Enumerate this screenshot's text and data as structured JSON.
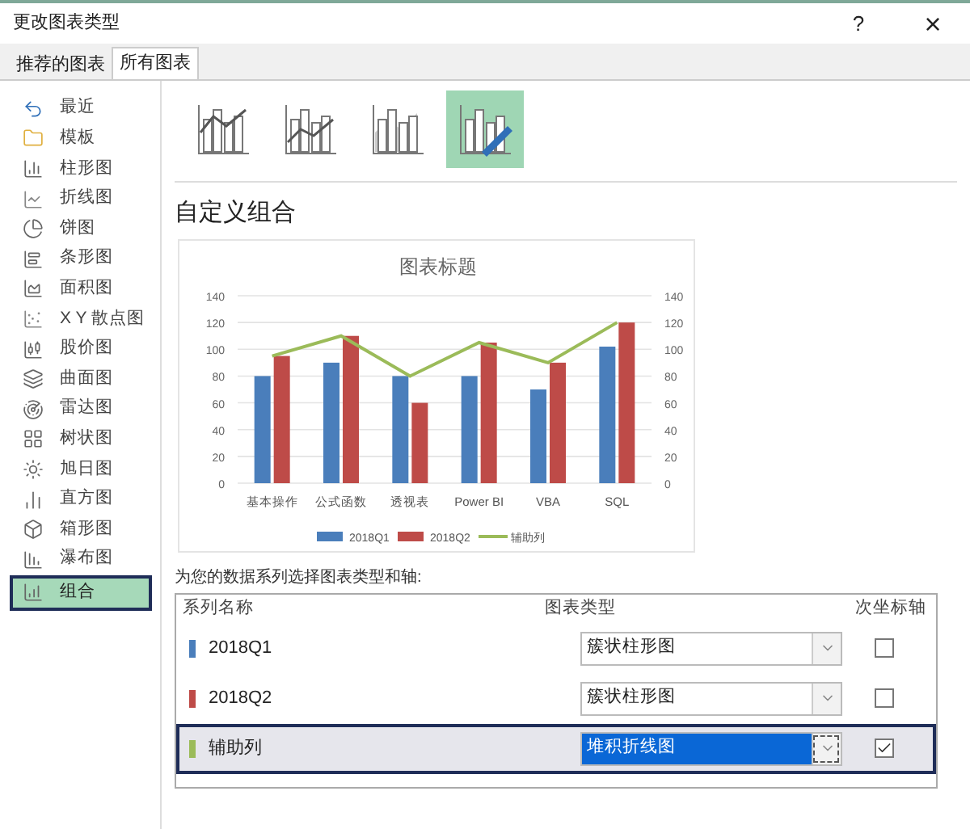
{
  "window": {
    "title": "更改图表类型",
    "help": "?",
    "close": "×"
  },
  "tabs": [
    {
      "label": "推荐的图表",
      "selected": false
    },
    {
      "label": "所有图表",
      "selected": true
    }
  ],
  "sidebar": {
    "items": [
      {
        "label": "最近",
        "selected": false
      },
      {
        "label": "模板",
        "selected": false
      },
      {
        "label": "柱形图",
        "selected": false
      },
      {
        "label": "折线图",
        "selected": false
      },
      {
        "label": "饼图",
        "selected": false
      },
      {
        "label": "条形图",
        "selected": false
      },
      {
        "label": "面积图",
        "selected": false
      },
      {
        "label": "X Y 散点图",
        "selected": false
      },
      {
        "label": "股价图",
        "selected": false
      },
      {
        "label": "曲面图",
        "selected": false
      },
      {
        "label": "雷达图",
        "selected": false
      },
      {
        "label": "树状图",
        "selected": false
      },
      {
        "label": "旭日图",
        "selected": false
      },
      {
        "label": "直方图",
        "selected": false
      },
      {
        "label": "箱形图",
        "selected": false
      },
      {
        "label": "瀑布图",
        "selected": false
      },
      {
        "label": "组合",
        "selected": true
      }
    ]
  },
  "subtypes": [
    {
      "selected": false
    },
    {
      "selected": false
    },
    {
      "selected": false
    },
    {
      "selected": true
    }
  ],
  "heading": "自定义组合",
  "chart": {
    "chart_data": {
      "type": "bar",
      "title": "图表标题",
      "categories": [
        "基本操作",
        "公式函数",
        "透视表",
        "Power BI",
        "VBA",
        "SQL"
      ],
      "series": [
        {
          "name": "2018Q1",
          "color": "#4a7ebb",
          "type": "bar",
          "values": [
            80,
            90,
            80,
            80,
            70,
            102
          ]
        },
        {
          "name": "2018Q2",
          "color": "#be4b48",
          "type": "bar",
          "values": [
            95,
            110,
            60,
            105,
            90,
            120
          ]
        },
        {
          "name": "辅助列",
          "color": "#9bbb59",
          "type": "line",
          "values": [
            95,
            110,
            80,
            105,
            90,
            120
          ]
        }
      ],
      "grid": true,
      "legend": "bottom",
      "ylim": [
        0,
        140
      ],
      "yticks": [
        0,
        20,
        40,
        60,
        80,
        100,
        120,
        140
      ]
    },
    "secondary_axis_labels": [
      "140",
      "120",
      "100",
      "80",
      "60",
      "40",
      "20",
      "0"
    ]
  },
  "series_prompt": "为您的数据系列选择图表类型和轴:",
  "series_table": {
    "columns": [
      "系列名称",
      "图表类型",
      "次坐标轴"
    ],
    "rows": [
      {
        "name": "2018Q1",
        "color": "#4a7ebb",
        "chart_type": "簇状柱形图",
        "secondary_axis": false,
        "selected": false
      },
      {
        "name": "2018Q2",
        "color": "#be4b48",
        "chart_type": "簇状柱形图",
        "secondary_axis": false,
        "selected": false
      },
      {
        "name": "辅助列",
        "color": "#9bbb59",
        "chart_type": "堆积折线图",
        "secondary_axis": true,
        "selected": true
      }
    ]
  }
}
